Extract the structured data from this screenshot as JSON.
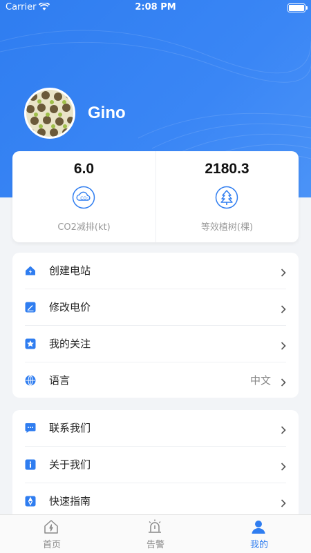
{
  "status_bar": {
    "carrier": "Carrier",
    "time": "2:08 PM"
  },
  "profile": {
    "username": "Gino"
  },
  "stats": [
    {
      "value": "6.0",
      "label": "CO2减排(kt)",
      "icon": "co2-cloud-icon"
    },
    {
      "value": "2180.3",
      "label": "等效植树(棵)",
      "icon": "tree-icon"
    }
  ],
  "menu_group1": [
    {
      "label": "创建电站",
      "icon": "home-lightning-icon"
    },
    {
      "label": "修改电价",
      "icon": "edit-icon"
    },
    {
      "label": "我的关注",
      "icon": "star-icon"
    },
    {
      "label": "语言",
      "value": "中文",
      "icon": "globe-icon"
    }
  ],
  "menu_group2": [
    {
      "label": "联系我们",
      "icon": "chat-icon"
    },
    {
      "label": "关于我们",
      "icon": "info-icon"
    },
    {
      "label": "快速指南",
      "icon": "compass-icon"
    }
  ],
  "tabs": [
    {
      "label": "首页",
      "icon": "home-icon"
    },
    {
      "label": "告警",
      "icon": "alarm-icon"
    },
    {
      "label": "我的",
      "icon": "user-icon",
      "active": true
    }
  ],
  "colors": {
    "primary": "#2f7df0",
    "background": "#f2f4f7"
  }
}
